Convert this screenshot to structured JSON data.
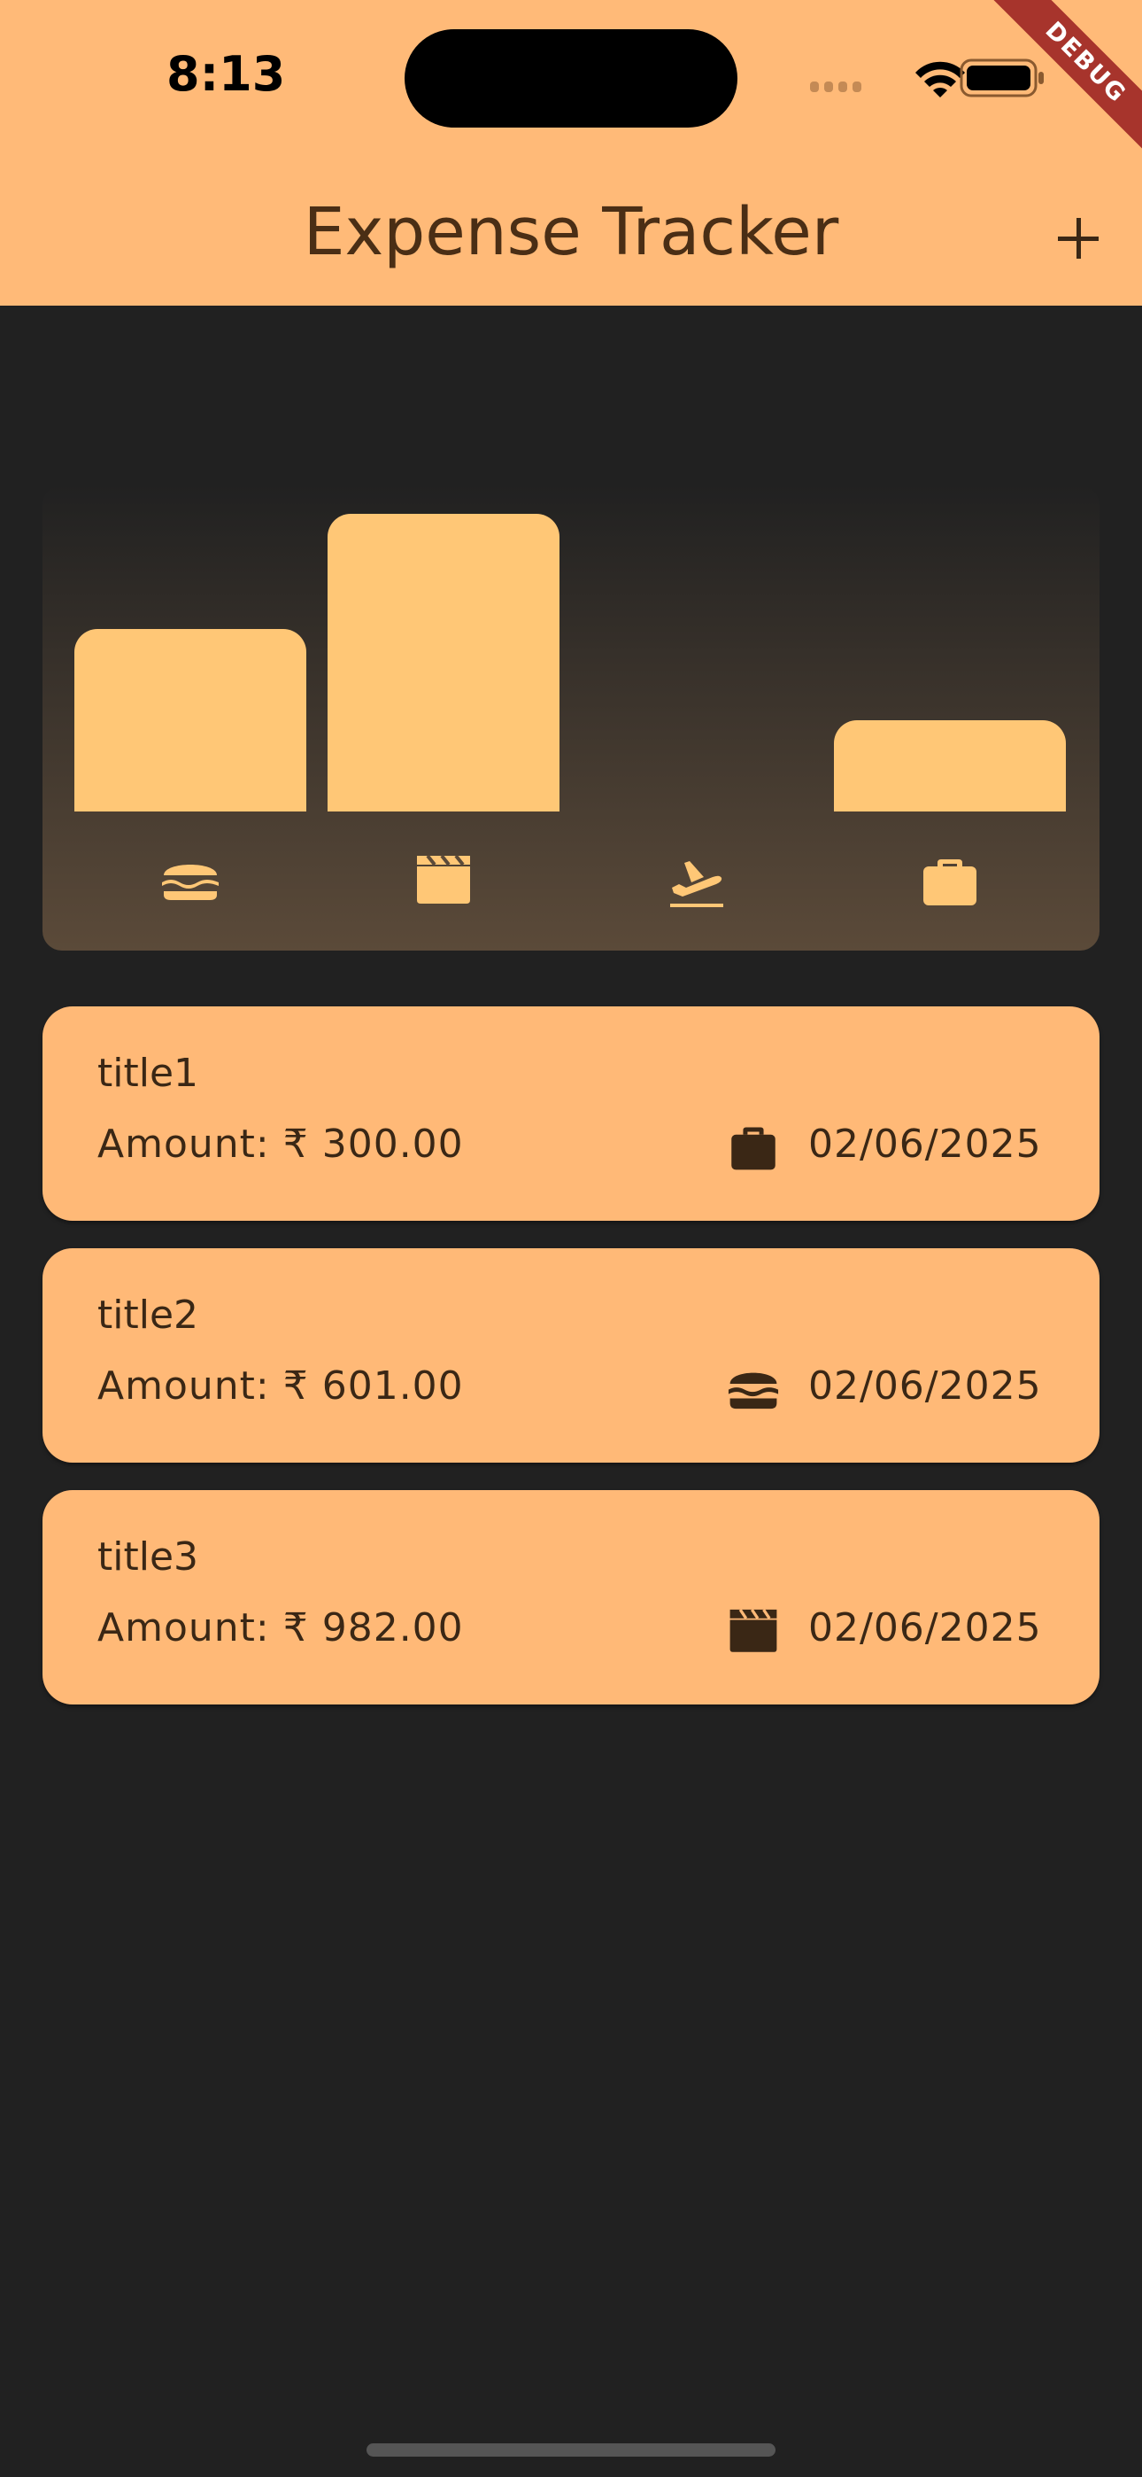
{
  "status_bar": {
    "time": "8:13"
  },
  "debug_banner": "DEBUG",
  "app_bar": {
    "title": "Expense Tracker",
    "add_icon": "plus-icon"
  },
  "chart_data": {
    "type": "bar",
    "categories": [
      "food",
      "leisure",
      "travel",
      "work"
    ],
    "category_icons": [
      "hamburger-icon",
      "clapperboard-icon",
      "flight-takeoff-icon",
      "briefcase-icon"
    ],
    "values": [
      601,
      982,
      0,
      300
    ],
    "bar_color": "#FFC776",
    "title": "",
    "xlabel": "",
    "ylabel": ""
  },
  "expenses": [
    {
      "title": "title1",
      "amount_label": "Amount:",
      "amount": "₹ 300.00",
      "category_icon": "briefcase-icon",
      "date": "02/06/2025"
    },
    {
      "title": "title2",
      "amount_label": "Amount:",
      "amount": "₹ 601.00",
      "category_icon": "hamburger-icon",
      "date": "02/06/2025"
    },
    {
      "title": "title3",
      "amount_label": "Amount:",
      "amount": "₹ 982.00",
      "category_icon": "clapperboard-icon",
      "date": "02/06/2025"
    }
  ],
  "colors": {
    "app_bar": "#FFBA78",
    "background": "#212121",
    "card": "#FFB977",
    "text_dark": "#3A2715",
    "bar": "#FFC776"
  }
}
